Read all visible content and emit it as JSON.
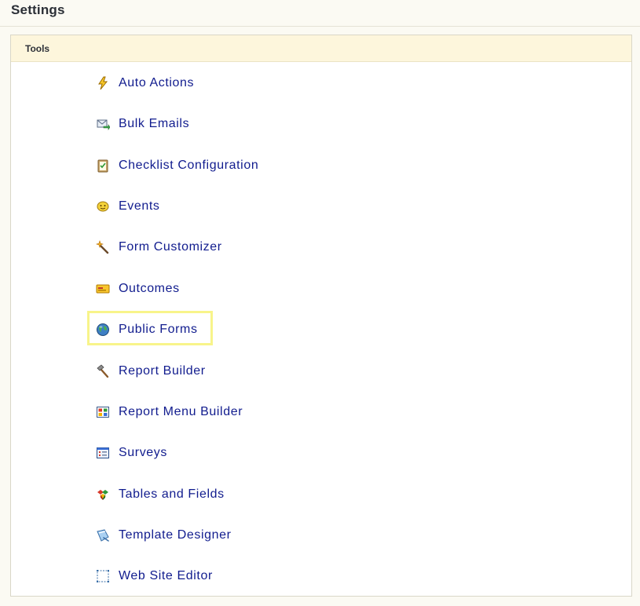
{
  "page": {
    "title": "Settings"
  },
  "panel": {
    "header": "Tools",
    "items": [
      {
        "label": "Auto Actions",
        "icon": "lightning-bolt-icon"
      },
      {
        "label": "Bulk Emails",
        "icon": "bulk-email-icon"
      },
      {
        "label": "Checklist Configuration",
        "icon": "checklist-clipboard-icon"
      },
      {
        "label": "Events",
        "icon": "events-smiley-icon"
      },
      {
        "label": "Form Customizer",
        "icon": "magic-wand-icon"
      },
      {
        "label": "Outcomes",
        "icon": "outcomes-card-icon"
      },
      {
        "label": "Public Forms",
        "icon": "globe-icon",
        "highlighted": true
      },
      {
        "label": "Report Builder",
        "icon": "hammer-icon"
      },
      {
        "label": "Report Menu Builder",
        "icon": "color-grid-menu-icon"
      },
      {
        "label": "Surveys",
        "icon": "survey-form-icon"
      },
      {
        "label": "Tables and Fields",
        "icon": "tables-fields-blocks-icon"
      },
      {
        "label": "Template Designer",
        "icon": "template-brush-icon"
      },
      {
        "label": "Web Site Editor",
        "icon": "website-frame-icon"
      }
    ]
  },
  "colors": {
    "link": "#111c8e",
    "header_bg": "#fdf6dc",
    "highlight": "#f8f48a",
    "page_bg": "#fbfaf3"
  }
}
